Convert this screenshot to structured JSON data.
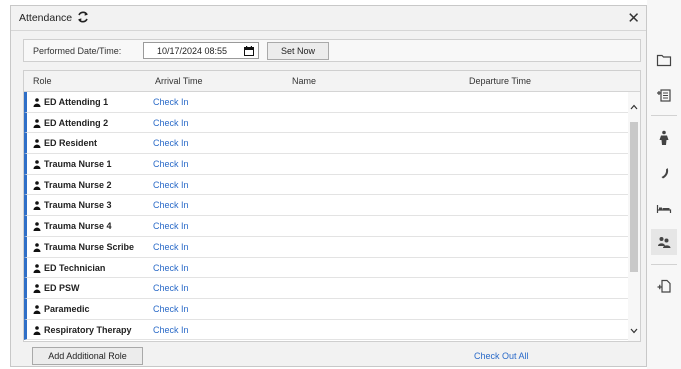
{
  "dialog": {
    "title": "Attendance",
    "date_label": "Performed Date/Time:",
    "date_value": "10/17/2024 08:55",
    "set_now_label": "Set Now"
  },
  "table": {
    "headers": {
      "role": "Role",
      "arrival": "Arrival Time",
      "name": "Name",
      "departure": "Departure Time"
    },
    "check_in_label": "Check In",
    "rows": [
      {
        "role": "ED Attending 1"
      },
      {
        "role": "ED Attending 2"
      },
      {
        "role": "ED Resident"
      },
      {
        "role": "Trauma Nurse 1"
      },
      {
        "role": "Trauma Nurse 2"
      },
      {
        "role": "Trauma Nurse 3"
      },
      {
        "role": "Trauma Nurse 4"
      },
      {
        "role": "Trauma Nurse Scribe"
      },
      {
        "role": "ED Technician"
      },
      {
        "role": "ED PSW"
      },
      {
        "role": "Paramedic"
      },
      {
        "role": "Respiratory Therapy"
      }
    ]
  },
  "footer": {
    "add_role_label": "Add Additional Role",
    "check_out_all_label": "Check Out All"
  },
  "sidebar": {
    "icons": [
      "folder-icon",
      "add-note-icon",
      "person-standing-icon",
      "phone-icon",
      "bed-icon",
      "team-icon",
      "add-document-icon"
    ],
    "active": "team-icon"
  },
  "colors": {
    "accent": "#2f6fc7",
    "link": "#2a6ac8"
  }
}
